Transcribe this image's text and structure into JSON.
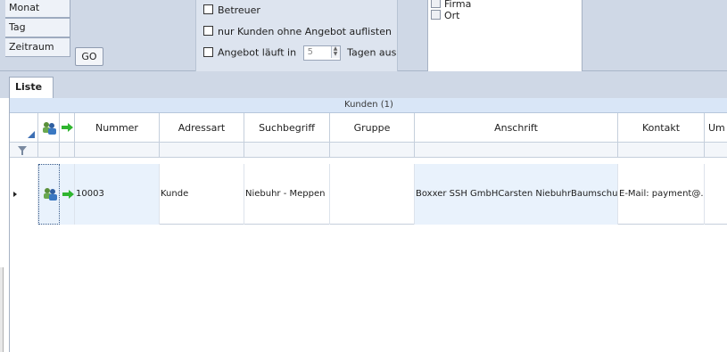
{
  "period_tabs": [
    "Monat",
    "Tag",
    "Zeitraum"
  ],
  "go_button": "GO",
  "options": {
    "betreuer": "Betreuer",
    "ohne_angebot": "nur Kunden ohne Angebot auflisten",
    "angebot_prefix": "Angebot läuft in",
    "angebot_days": "5",
    "angebot_suffix": "Tagen aus"
  },
  "right_list": [
    "Firma",
    "Ort"
  ],
  "tabs": [
    "Liste"
  ],
  "grid": {
    "group_title": "Kunden (1)",
    "columns": [
      "Nummer",
      "Adressart",
      "Suchbegriff",
      "Gruppe",
      "Anschrift",
      "Kontakt",
      "Um"
    ],
    "rows": [
      {
        "nummer": "10003",
        "adressart": "Kunde",
        "suchbegriff": "Niebuhr - Meppen",
        "gruppe": "",
        "anschrift": "Boxxer SSH GmbHCarsten NiebuhrBaumschule...",
        "kontakt": "E-Mail: payment@..."
      }
    ]
  },
  "colors": {
    "panel": "#cfd8e6",
    "group_header": "#d9e6f7",
    "row_highlight": "#e9f2fc"
  }
}
